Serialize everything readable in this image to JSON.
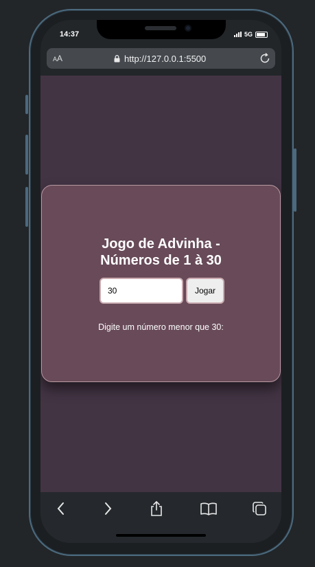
{
  "status_bar": {
    "time": "14:37",
    "network": "5G"
  },
  "browser": {
    "text_size_label_small": "A",
    "text_size_label_large": "A",
    "url": "http://127.0.0.1:5500",
    "icons": [
      "lock-icon",
      "reload-icon",
      "back-icon",
      "forward-icon",
      "share-icon",
      "bookmarks-icon",
      "tabs-icon"
    ]
  },
  "game": {
    "title": "Jogo de Advinha -\nNúmeros de 1 à 30",
    "input_value": "30",
    "play_button": "Jogar",
    "hint": "Digite um número menor que 30:"
  },
  "colors": {
    "page_background": "#433444",
    "card_background": "#684a58",
    "card_border": "#b99aa2",
    "frame": "#4c6a7e"
  }
}
